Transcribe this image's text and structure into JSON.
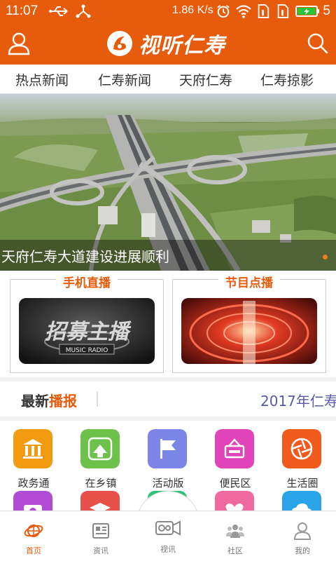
{
  "status_bar": {
    "time": "11:07",
    "speed": "1.86 K/s",
    "level": "5",
    "icons": [
      "usb-icon",
      "transfer-icon",
      "alarm-icon",
      "wifi-icon",
      "sim1-icon",
      "sim2-icon",
      "battery-icon"
    ]
  },
  "header": {
    "logo_text": "视听仁寿",
    "icons": [
      "user-icon",
      "search-icon"
    ],
    "brand_color": "#e65c0c"
  },
  "category_tabs": [
    {
      "label": "热点新闻"
    },
    {
      "label": "仁寿新闻"
    },
    {
      "label": "天府仁寿"
    },
    {
      "label": "仁寿掠影"
    }
  ],
  "banner": {
    "caption": "天府仁寿大道建设进展顺利"
  },
  "cards": [
    {
      "title": "手机直播",
      "art_text": "招募主播",
      "art_sub": "MUSIC RADIO"
    },
    {
      "title": "节目点播"
    }
  ],
  "ticker": {
    "label_main": "最新",
    "label_accent": "播报",
    "text": "2017年仁寿"
  },
  "grid": [
    {
      "label": "政务通",
      "icon": "government-building-icon",
      "color": "#f29a10"
    },
    {
      "label": "在乡镇",
      "icon": "town-house-icon",
      "color": "#6cc24a"
    },
    {
      "label": "活动版",
      "icon": "flag-icon",
      "color": "#7b86e8"
    },
    {
      "label": "便民区",
      "icon": "hanging-sign-icon",
      "color": "#e044b8"
    },
    {
      "label": "生活圈",
      "icon": "aperture-icon",
      "color": "#f05a1c"
    },
    {
      "label": "",
      "icon": "camera-icon",
      "color": "#b24bd6"
    },
    {
      "label": "",
      "icon": "graduation-cap-icon",
      "color": "#e8504a"
    },
    {
      "label": "",
      "icon": "briefcase-icon",
      "color": "#2fc07a"
    },
    {
      "label": "",
      "icon": "heart-paw-icon",
      "color": "#f06aa0"
    },
    {
      "label": "",
      "icon": "cloud-icon",
      "color": "#2aa3e8"
    }
  ],
  "bottom_nav": [
    {
      "label": "首页",
      "icon": "globe-icon",
      "active": true
    },
    {
      "label": "资讯",
      "icon": "newspaper-icon",
      "active": false
    },
    {
      "label": "视讯",
      "icon": "video-camera-icon",
      "active": false
    },
    {
      "label": "社区",
      "icon": "community-icon",
      "active": false
    },
    {
      "label": "我的",
      "icon": "profile-icon",
      "active": false
    }
  ]
}
